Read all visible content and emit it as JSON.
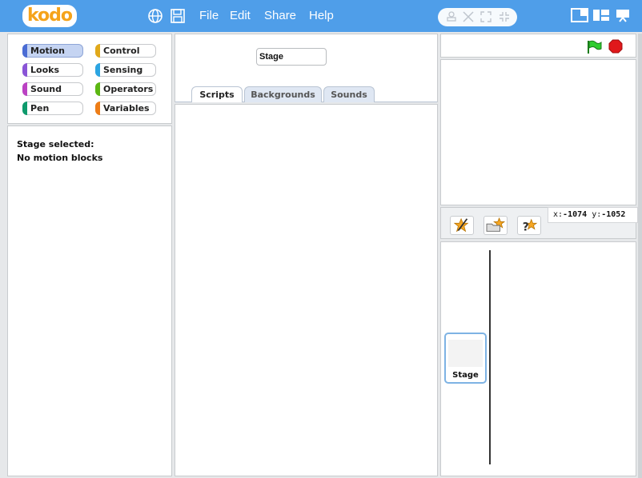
{
  "topbar": {
    "logo_text": "kodo",
    "icons": [
      "globe-icon",
      "save-icon"
    ],
    "menu": [
      "File",
      "Edit",
      "Share",
      "Help"
    ],
    "tools": [
      "duplicate-stamp-icon",
      "delete-scissors-icon",
      "grow-icon",
      "shrink-icon"
    ],
    "layout_buttons": [
      "small-stage-layout-icon",
      "normal-layout-icon",
      "presentation-mode-icon"
    ],
    "accent": "#4f9ee9"
  },
  "categories": [
    {
      "label": "Motion",
      "color": "#4a6cd4",
      "selected": true
    },
    {
      "label": "Control",
      "color": "#e1a91a"
    },
    {
      "label": "Looks",
      "color": "#8a55d7"
    },
    {
      "label": "Sensing",
      "color": "#2ca5e2"
    },
    {
      "label": "Sound",
      "color": "#bb42c3"
    },
    {
      "label": "Operators",
      "color": "#5cb712"
    },
    {
      "label": "Pen",
      "color": "#0e9a6c"
    },
    {
      "label": "Variables",
      "color": "#ee7d16"
    }
  ],
  "blocks_panel": {
    "line1": "Stage selected:",
    "line2": "No motion blocks"
  },
  "scripts": {
    "name_value": "Stage",
    "tabs": [
      "Scripts",
      "Backgrounds",
      "Sounds"
    ],
    "active_tab": "Scripts"
  },
  "stage": {
    "coords_x_label": "x:",
    "coords_x": "-1074",
    "coords_y_label": "y:",
    "coords_y": "-1052"
  },
  "sprite_tools": [
    "paint-new-sprite-icon",
    "choose-sprite-from-file-icon",
    "random-surprise-sprite-icon"
  ],
  "sprite_list": {
    "stage_label": "Stage"
  }
}
